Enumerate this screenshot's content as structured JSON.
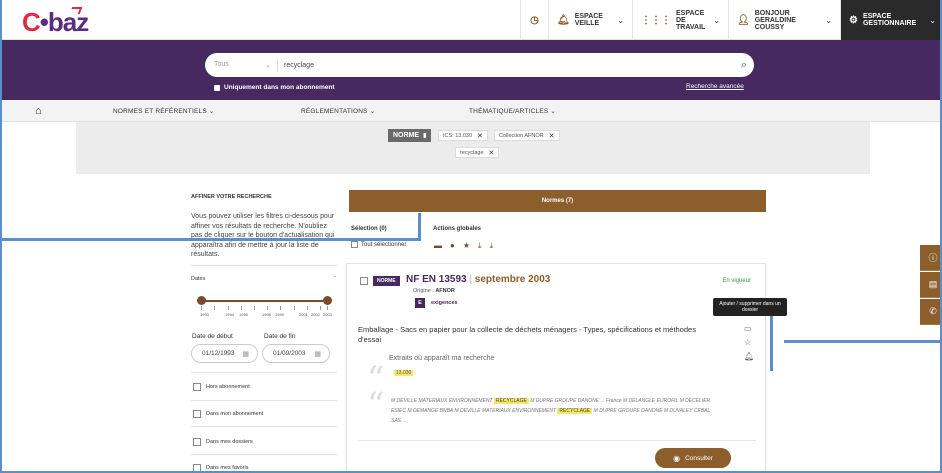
{
  "topbar": {
    "logo_text": "Cobaz",
    "history_icon": "history-icon",
    "items": [
      {
        "label": "ESPACE VEILLE",
        "icon": "bell-icon"
      },
      {
        "label": "ESPACE DE TRAVAIL",
        "icon": "grid-icon"
      },
      {
        "label_line1": "BONJOUR",
        "label_line2": "GERALDINE COUSSY",
        "icon": "user-icon"
      },
      {
        "label": "ESPACE GESTIONNAIRE",
        "icon": "gear-icon"
      }
    ]
  },
  "search": {
    "scope": "Tous",
    "query": "recyclage",
    "subscription_only_label": "Uniquement dans mon abonnement",
    "advanced_label": "Recherche avancée"
  },
  "nav": {
    "items": [
      "NORMES ET RÉFÉRENTIELS",
      "RÉGLEMENTATIONS",
      "THÉMATIQUE/ARTICLES"
    ]
  },
  "filters_active": {
    "norme": "NORME",
    "chips": [
      "ICS: 13.030",
      "Collection AFNOR",
      "recyclage"
    ]
  },
  "refine": {
    "title": "AFFINER VOTRE RECHERCHE",
    "description": "Vous pouvez utiliser les filtres ci-dessous pour affiner vos résultats de recherche. N'oubliez pas de cliquer sur le bouton d'actualisation qui apparaîtra afin de mettre à jour la liste de résultats.",
    "dates_label": "Dates",
    "tick_labels": [
      "1993",
      "1994",
      "1995",
      "1996",
      "1998",
      "1999",
      "2001",
      "2002",
      "2003"
    ],
    "start_label": "Date de début",
    "end_label": "Date de fin",
    "start_value": "01/12/1993",
    "end_value": "01/09/2003",
    "checkboxes": [
      "Hors abonnement",
      "Dans mon abonnement",
      "Dans mes dossiers",
      "Dans mes favoris"
    ]
  },
  "results": {
    "header": "Normes (7)",
    "selection_label": "Sélection (0)",
    "select_all_label": "Tout sélectionner",
    "global_actions_label": "Actions globales"
  },
  "card": {
    "tag": "NORME",
    "ref": "NF EN 13593",
    "date": "septembre 2003",
    "status": "En vigueur",
    "origin_label": "Origine :",
    "origin_value": "AFNOR",
    "badge": "E",
    "badge_label": "exigences",
    "title": "Emballage - Sacs en papier pour la collecte de déchets ménagers - Types, spécifications et méthodes d'essai",
    "extract_label": "Extraits où apparaît ma recherche",
    "ics": "13.030",
    "snippet_a": "M DEVILLE MATERIAUX ENVIRONNEMENT ",
    "snippet_hl1": "RECYCLAGE",
    "snippet_b": " M DUPRE GROUPE DANONE ... France M DELANGLE EUROFIL M DECELIER ESIEC M DEMANGE BNBA M DEVILLE MATERIAUX ENVIRONNEMENT ",
    "snippet_hl2": "RECYCLAGE",
    "snippet_c": " M DUPRE GROUPE DANONE M DUVALEY CEBAL SAS ...",
    "consult_label": "Consulter",
    "tooltip": "Ajouter / supprimer dans un dossier"
  }
}
